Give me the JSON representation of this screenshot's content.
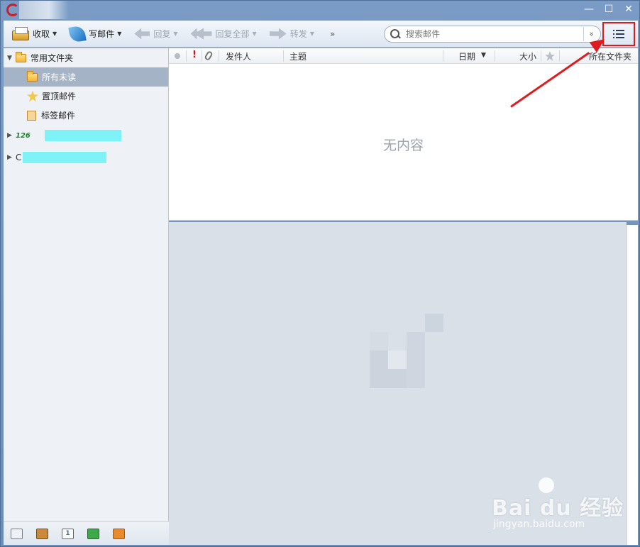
{
  "window": {
    "controls": {
      "minimize": "—",
      "maximize": "☐",
      "close": "✕"
    }
  },
  "toolbar": {
    "receive_label": "收取",
    "compose_label": "写邮件",
    "reply_label": "回复",
    "reply_all_label": "回复全部",
    "forward_label": "转发",
    "more_label": "»",
    "search_placeholder": "搜索邮件",
    "search_options_label": "»"
  },
  "sidebar": {
    "favorites_label": "常用文件夹",
    "items": [
      {
        "label": "所有未读",
        "selected": true
      },
      {
        "label": "置顶邮件",
        "selected": false
      },
      {
        "label": "标签邮件",
        "selected": false
      }
    ],
    "accounts": [
      {
        "badge": "126"
      },
      {
        "badge": "C"
      }
    ],
    "footer_calendar_day": "1"
  },
  "maillist": {
    "columns": {
      "sender": "发件人",
      "subject": "主题",
      "date": "日期",
      "size": "大小",
      "folder": "所在文件夹"
    },
    "empty_text": "无内容"
  },
  "watermark": {
    "main": "Bai du 经验",
    "sub": "jingyan.baidu.com"
  },
  "colors": {
    "selection": "#a4b3c6",
    "annotation": "#e01b1f",
    "account_badge": "#178a2c",
    "redaction": "#7ff2f8"
  }
}
